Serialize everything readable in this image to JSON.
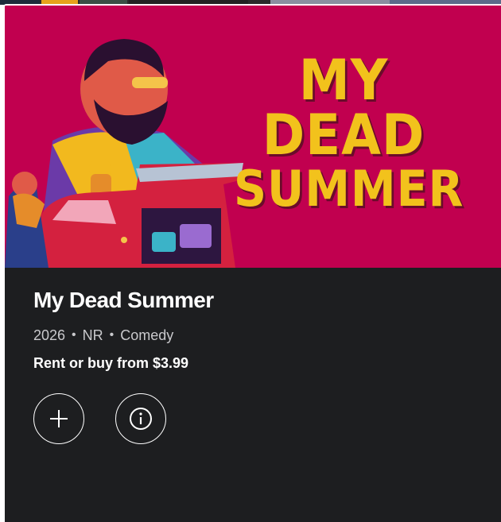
{
  "poster": {
    "title_line1": "MY DEAD",
    "title_line2": "SUMMER"
  },
  "movie": {
    "title": "My Dead Summer",
    "year": "2026",
    "rating": "NR",
    "genre": "Comedy",
    "separator": "•",
    "price_text": "Rent or buy from $3.99"
  },
  "actions": {
    "add_icon": "plus-icon",
    "info_icon": "info-icon"
  },
  "colors": {
    "poster_bg": "#c1004f",
    "poster_title": "#f2c21c",
    "card_bg": "#1d1e20",
    "meta_text": "#c9c9cc"
  }
}
